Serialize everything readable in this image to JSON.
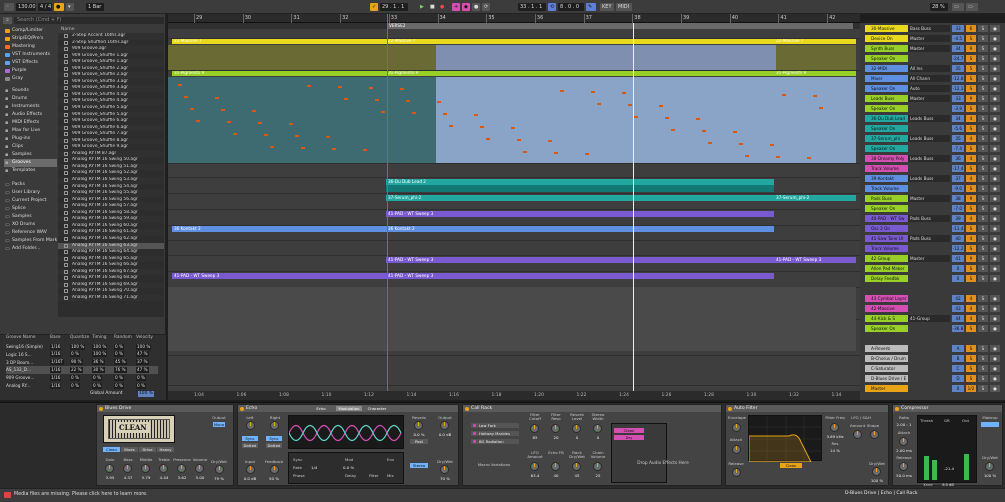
{
  "transport": {
    "tempo": "130.00",
    "signature": "4 / 4",
    "bar_mode": "1 Bar",
    "position": "29 . 1 . 1",
    "loop_start": "33 . 1 . 1",
    "loop_length": "8 . 0 . 0",
    "cpu": "28 %",
    "key": "KEY",
    "midi": "MIDI"
  },
  "browser": {
    "search_placeholder": "Search (Cmd + F)",
    "categories": [
      {
        "label": "Comp/Limiter",
        "color": "#e8a317"
      },
      {
        "label": "Strip/EQ/Pre's",
        "color": "#e8a317"
      },
      {
        "label": "Mastering",
        "color": "#f06b2c"
      },
      {
        "label": "VST Instruments",
        "color": "#5da3e8"
      },
      {
        "label": "VST Effects",
        "color": "#5da3e8"
      },
      {
        "label": "Purple",
        "color": "#a86ed8"
      },
      {
        "label": "Gray",
        "color": "#888888"
      }
    ],
    "library": [
      "Sounds",
      "Drums",
      "Instruments",
      "Audio Effects",
      "MIDI Effects",
      "Max for Live",
      "Plug-ins",
      "Clips",
      "Samples",
      "Grooves",
      "Templates"
    ],
    "places": [
      "Packs",
      "User Library",
      "Current Project",
      "Splice",
      "Samples",
      "XO Drums",
      "Reference WAV",
      "Samples From Mark",
      "Add Folder..."
    ],
    "files_header": "Name",
    "files": [
      "2-Step Accent 16ths.agr",
      "2-Step Shuffled 16ths.agr",
      "909 Groove.agr",
      "909 Groove_Shuffle 1.agr",
      "909 Groove_Shuffle 1.agr",
      "909 Groove_Shuffle 2.agr",
      "909 Groove_Shuffle 2.agr",
      "909 Groove_Shuffle 3.agr",
      "909 Groove_Shuffle 3.agr",
      "909 Groove_Shuffle 4.agr",
      "909 Groove_Shuffle 4.agr",
      "909 Groove_Shuffle 5.agr",
      "909 Groove_Shuffle 5.agr",
      "909 Groove_Shuffle 6.agr",
      "909 Groove_Shuffle 6.agr",
      "909 Groove_Shuffle 7.agr",
      "909 Groove_Shuffle 8.agr",
      "909 Groove_Shuffle 9.agr",
      "Analog RYTM 87.agr",
      "Analog RYTM 16 Swing 50.agr",
      "Analog RYTM 16 Swing 51.agr",
      "Analog RYTM 16 Swing 52.agr",
      "Analog RYTM 16 Swing 53.agr",
      "Analog RYTM 16 Swing 54.agr",
      "Analog RYTM 16 Swing 55.agr",
      "Analog RYTM 16 Swing 56.agr",
      "Analog RYTM 16 Swing 57.agr",
      "Analog RYTM 16 Swing 58.agr",
      "Analog RYTM 16 Swing 59.agr",
      "Analog RYTM 16 Swing 60.agr",
      "Analog RYTM 16 Swing 61.agr",
      "Analog RYTM 16 Swing 62.agr",
      "Analog RYTM 16 Swing 63.agr",
      "Analog RYTM 16 Swing 64.agr",
      "Analog RYTM 16 Swing 65.agr",
      "Analog RYTM 16 Swing 66.agr",
      "Analog RYTM 16 Swing 67.agr",
      "Analog RYTM 16 Swing 68.agr",
      "Analog RYTM 16 Swing 69.agr",
      "Analog RYTM 16 Swing 70.agr",
      "Analog RYTM 16 Swing 71.agr"
    ]
  },
  "groove_pool": {
    "headers": [
      "Groove Name",
      "Base",
      "Quantize",
      "Timing",
      "Random",
      "Velocity"
    ],
    "rows": [
      [
        "Swing16 (Simple)",
        "1/16",
        "100 %",
        "100 %",
        "0 %",
        "100 %"
      ],
      [
        "Logic 16 S...",
        "1/16",
        "0 %",
        "100 %",
        "0 %",
        "47 %"
      ],
      [
        "3 DP Boom...",
        "1/16T",
        "90 %",
        "36 %",
        "45 %",
        "37 %"
      ],
      [
        "AS_132_D...",
        "1/16",
        "22 %",
        "30 %",
        "76 %",
        "47 %"
      ],
      [
        "909 Groove...",
        "1/16",
        "0 %",
        "0 %",
        "0 %",
        "0 %"
      ],
      [
        "Analog RY...",
        "1/16",
        "0 %",
        "0 %",
        "0 %",
        "0 %"
      ]
    ],
    "global_label": "Global Amount",
    "global_value": "100 %"
  },
  "ruler": {
    "bars": [
      "29",
      "30",
      "31",
      "32",
      "33",
      "34",
      "35",
      "36",
      "37",
      "38",
      "39",
      "40",
      "41",
      "42"
    ],
    "section": "VERSE2"
  },
  "clips": {
    "massive_a": "22-Massive 7",
    "massive_b": "22-Massive 7",
    "massive_c": "22-Massive 7",
    "pigments_a": "31-Pigments 9",
    "pigments_b": "31-Pigments 9",
    "pigments_c": "31-Pigments 9",
    "dub_lead": "36-Du Dub Lead 2",
    "serum_a": "37-Serum_phi-2",
    "serum_b": "37-Serum_phi-2",
    "pad_a": "41-PAD - WT Sweep 3",
    "pad_b": "41-PAD - WT Sweep 3",
    "pad_c": "41-PAD - WT Sweep 3",
    "pad_d": "41-PAD - WT Sweep 3",
    "pad_e": "41-PAD - WT Sweep 3",
    "kontakt_a": "36 Kontakt 2",
    "kontakt_b": "36 Kontakt 2"
  },
  "timeline_bottom": [
    "1:04",
    "1:06",
    "1:08",
    "1:10",
    "1:12",
    "1:14",
    "1:16",
    "1:18",
    "1:20",
    "1:22",
    "1:24",
    "1:26",
    "1:28",
    "1:30",
    "1:32",
    "1:34"
  ],
  "mixer": {
    "rows": [
      {
        "name": "30-Massive",
        "dev": "Bass Buss",
        "vol": "33",
        "num": "6",
        "color": "#e8d91c"
      },
      {
        "name": "Device On",
        "dev": "Master",
        "vol": "-4.5",
        "num": "S",
        "color": "#e8d91c"
      },
      {
        "name": "Synth Buss",
        "dev": "Master",
        "vol": "34",
        "num": "9",
        "color": "#98d028"
      },
      {
        "name": "Speaker On",
        "dev": "",
        "vol": "-24.7",
        "num": "S",
        "color": "#98d028"
      },
      {
        "name": "32-MIDI",
        "dev": "All Ins",
        "vol": "35",
        "num": "5",
        "color": "#5e8fe0"
      },
      {
        "name": "Mixer",
        "dev": "All Chann",
        "vol": "-12.8",
        "num": "S",
        "color": "#5e8fe0"
      },
      {
        "name": "Speaker On",
        "dev": "Auto",
        "vol": "-12.1",
        "num": "S",
        "color": "#5e8fe0"
      },
      {
        "name": "Leads Buss",
        "dev": "Master",
        "vol": "33",
        "num": "9",
        "color": "#98d028"
      },
      {
        "name": "Speaker On",
        "dev": "",
        "vol": "-3.9",
        "num": "S",
        "color": "#98d028"
      },
      {
        "name": "36-Du Dub Lead",
        "dev": "Leads Buss",
        "vol": "34",
        "num": "4",
        "color": "#22a8a0"
      },
      {
        "name": "Speaker On",
        "dev": "",
        "vol": "-5.6",
        "num": "S",
        "color": "#22a8a0"
      },
      {
        "name": "37-Serum_phi",
        "dev": "Leads Buss",
        "vol": "35",
        "num": "4",
        "color": "#22a8a0"
      },
      {
        "name": "Speaker On",
        "dev": "",
        "vol": "-7.4",
        "num": "S",
        "color": "#22a8a0"
      },
      {
        "name": "38-Dreamy Poly",
        "dev": "Leads Buss",
        "vol": "36",
        "num": "4",
        "color": "#d44fb2"
      },
      {
        "name": "Track Volume",
        "dev": "",
        "vol": "-17.4",
        "num": "S",
        "color": "#d44fb2"
      },
      {
        "name": "39-Kontakt",
        "dev": "Leads Buss",
        "vol": "37",
        "num": "4",
        "color": "#5e8fe0"
      },
      {
        "name": "Track Volume",
        "dev": "",
        "vol": "-9.0",
        "num": "S",
        "color": "#5e8fe0"
      },
      {
        "name": "Pads Buss",
        "dev": "Master",
        "vol": "38",
        "num": "9",
        "color": "#98d028"
      },
      {
        "name": "Speaker On",
        "dev": "",
        "vol": "-7.0",
        "num": "S",
        "color": "#98d028"
      },
      {
        "name": "40-PAD - WT Sw",
        "dev": "Pads Buss",
        "vol": "39",
        "num": "4",
        "color": "#7a5ad0"
      },
      {
        "name": "Osc 2 On",
        "dev": "",
        "vol": "-11.4",
        "num": "S",
        "color": "#7a5ad0"
      },
      {
        "name": "41-Saw Tone Ul",
        "dev": "Pads Buss",
        "vol": "40",
        "num": "4",
        "color": "#7a5ad0"
      },
      {
        "name": "Track Volume",
        "dev": "",
        "vol": "-12.2",
        "num": "S",
        "color": "#7a5ad0"
      },
      {
        "name": "42 Group",
        "dev": "Master",
        "vol": "41",
        "num": "9",
        "color": "#98d028"
      },
      {
        "name": "Allen Pad Maker",
        "dev": "",
        "vol": "0",
        "num": "S",
        "color": "#98d028"
      },
      {
        "name": "Delay Feedbk",
        "dev": "",
        "vol": "0",
        "num": "S",
        "color": "#98d028"
      },
      {
        "name": "",
        "dev": "",
        "vol": "",
        "num": "",
        "color": "#3a3a3a"
      },
      {
        "name": "43 Cymbal Layer",
        "dev": "",
        "vol": "42",
        "num": "4",
        "color": "#d44fb2"
      },
      {
        "name": "42-Massive",
        "dev": "",
        "vol": "43",
        "num": "4",
        "color": "#d44fb2"
      },
      {
        "name": "44-Kick & S",
        "dev": "41-Group",
        "vol": "44",
        "num": "4",
        "color": "#98d028"
      },
      {
        "name": "Speaker On",
        "dev": "",
        "vol": "-36.8",
        "num": "S",
        "color": "#98d028"
      },
      {
        "name": "",
        "dev": "",
        "vol": "",
        "num": "",
        "color": "#3a3a3a"
      },
      {
        "name": "A-Reverb",
        "dev": "",
        "vol": "A",
        "num": "S",
        "color": "#bbbbbb"
      },
      {
        "name": "B-Chorus / Drum",
        "dev": "",
        "vol": "B",
        "num": "S",
        "color": "#bbbbbb"
      },
      {
        "name": "C-Saturator",
        "dev": "",
        "vol": "C",
        "num": "S",
        "color": "#bbbbbb"
      },
      {
        "name": "D-Blues Drive / E",
        "dev": "",
        "vol": "D",
        "num": "S",
        "color": "#bbbbbb"
      },
      {
        "name": "Master",
        "dev": "",
        "vol": "0",
        "num": "1/2",
        "color": "#e8a317"
      }
    ]
  },
  "devices": {
    "blues_drive": {
      "title": "Blues Drive",
      "screen": "CLEAN",
      "knobs": [
        "Gain",
        "Bass",
        "Middle",
        "Treble",
        "Presence",
        "Volume"
      ],
      "values": [
        "3.95",
        "4.37",
        "5.79",
        "4.44",
        "3.62",
        "5.00"
      ],
      "output": "Output",
      "mono": "Mono",
      "drywet": "Dry/Wet",
      "drywet_val": "79 %",
      "modes": [
        "Clean",
        "Blues",
        "Drive",
        "Heavy"
      ]
    },
    "echo": {
      "title": "Echo",
      "tabs": [
        "Echo",
        "Modulation",
        "Character"
      ],
      "left": "Left",
      "right": "Right",
      "sync": "Sync",
      "dotted": "Dotted",
      "feedback": "Feedback",
      "reverb": "Reverb",
      "output": "Output",
      "drywet": "Dry/Wet",
      "input": "Input",
      "stereo": "Stereo",
      "rate": "Rate",
      "phase": "Phase",
      "mod": "Mod",
      "env": "Env",
      "delay": "Delay",
      "filter": "Filter",
      "mix": "Mix",
      "sync_val": "1/4",
      "feedback_val": "50 %",
      "reverb_val": "0.0 %",
      "mod_val": "0.0 %",
      "drywet_val": "70 %",
      "input_val": "0.0 dB",
      "output_val": "0.0 dB",
      "post": "Post"
    },
    "call_rack": {
      "title": "Call Rack",
      "chains": [
        "Low Fork",
        "Hallway Marbles",
        "BG Radiation"
      ],
      "macro": "Macro Variations",
      "knobs": [
        "Filter Cutoff",
        "Filter Reso",
        "Reverb Level",
        "Stereo Width",
        "LFO Amount",
        "Echo FB",
        "Rack Dry/Wet",
        "Chain Volume"
      ],
      "values": [
        "85",
        "20",
        "0",
        "0",
        "63.4",
        "40",
        "45",
        "25"
      ],
      "drop": "Drop Audio Effects Here",
      "chain_rows": [
        "Clean",
        "Dry"
      ]
    },
    "auto_filter": {
      "title": "Auto Filter",
      "freq": "Filter Freq",
      "res": "Res",
      "lfo": "LFO / S&H",
      "amount": "Amount",
      "shape": "Shape",
      "freq_val": "3.69 kHz",
      "res_val": "14 %",
      "env": "Envelope",
      "attack": "Attack",
      "release": "Release",
      "mode": "Clean",
      "drywet": "Dry/Wet",
      "drywet_val": "100 %"
    },
    "compressor": {
      "title": "Compressor",
      "attack": "Attack",
      "release": "Release",
      "ratio": "Ratio",
      "out": "Out",
      "gr": "GR",
      "thresh": "Thresh",
      "knee": "Knee",
      "makeup": "Makeup",
      "drywet": "Dry/Wet",
      "ratio_val": "2.00 : 1",
      "attack_val": "2.00 ms",
      "release_val": "50.0 ms",
      "knee_val": "6.0 dB",
      "drywet_val": "100 %",
      "meter_val": "-21.4"
    }
  },
  "status": {
    "message": "Media files are missing. Please click here to learn more.",
    "right": "D-Blues Drive | Echo | Call Rack"
  }
}
